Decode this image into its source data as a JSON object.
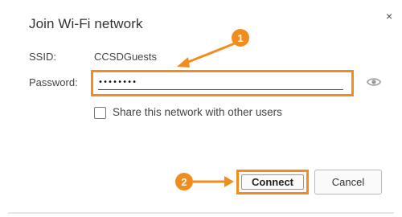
{
  "dialog": {
    "title": "Join Wi-Fi network",
    "close_glyph": "×",
    "ssid_label": "SSID:",
    "ssid_value": "CCSDGuests",
    "password_label": "Password:",
    "password_value": "********",
    "password_type": "password",
    "share_label": "Share this network with other users",
    "share_checked": false,
    "connect_label": "Connect",
    "cancel_label": "Cancel"
  },
  "annotations": {
    "step1": "1",
    "step2": "2",
    "highlight_color": "#f28c1c"
  },
  "icons": {
    "close": "close-icon",
    "eye": "eye-icon"
  }
}
